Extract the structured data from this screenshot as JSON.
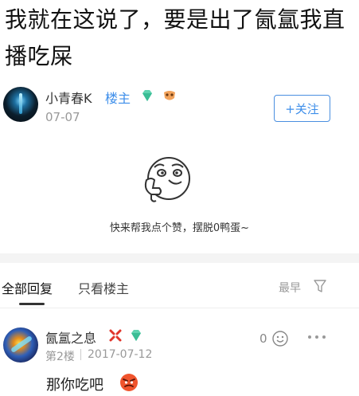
{
  "post": {
    "title": "我就在这说了，要是出了氤氲我直播吃屎"
  },
  "author": {
    "name": "小青春K",
    "owner_tag": "楼主",
    "date": "07-07",
    "follow_label": "+关注"
  },
  "empty_state": {
    "message": "快来帮我点个赞，摆脱0鸭蛋~"
  },
  "tabs": {
    "all": "全部回复",
    "owner_only": "只看楼主",
    "sort": "最早"
  },
  "reply": {
    "name": "氤氲之息",
    "floor": "第2楼",
    "date": "2017-07-12",
    "likes": "0",
    "text": "那你吃吧"
  },
  "colors": {
    "accent": "#3d8eea",
    "muted": "#999999",
    "divider": "#f4f4f4"
  }
}
